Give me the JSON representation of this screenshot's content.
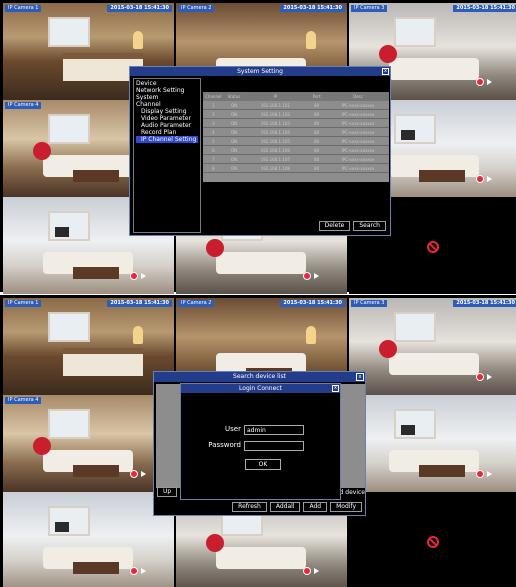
{
  "top": {
    "cells": [
      {
        "label": "IP Camera 1",
        "time": "2015-03-18 15:41:30",
        "scene": "bed"
      },
      {
        "label": "IP Camera 2",
        "time": "2015-03-18 15:41:30",
        "scene": "warm"
      },
      {
        "label": "IP Camera 3",
        "time": "2015-03-18 15:41:30",
        "scene": "grey"
      },
      {
        "label": "IP Camera 4",
        "time": "",
        "scene": "living"
      },
      {
        "label": "",
        "time": "",
        "scene": "warm"
      },
      {
        "label": "",
        "time": "",
        "scene": "white"
      },
      {
        "label": "",
        "time": "",
        "scene": "white"
      },
      {
        "label": "",
        "time": "",
        "scene": "grey"
      },
      {
        "label": "",
        "time": "",
        "scene": "dark"
      }
    ],
    "system_setting": {
      "title": "System Setting",
      "close": "x",
      "menu": [
        {
          "label": "Device",
          "sub": false,
          "active": false
        },
        {
          "label": "Network Setting",
          "sub": false,
          "active": false
        },
        {
          "label": "System",
          "sub": false,
          "active": false
        },
        {
          "label": "Channel",
          "sub": false,
          "active": false
        },
        {
          "label": "Display Setting",
          "sub": true,
          "active": false
        },
        {
          "label": "Video Parameter",
          "sub": true,
          "active": false
        },
        {
          "label": "Audio Parameter",
          "sub": true,
          "active": false
        },
        {
          "label": "Record Plan",
          "sub": true,
          "active": false
        },
        {
          "label": "IP Channel Setting",
          "sub": true,
          "active": true
        }
      ],
      "table": {
        "headers": [
          "Channel",
          "Status",
          "IP",
          "Port",
          "Desc"
        ],
        "rows": [
          [
            "1",
            "ON",
            "192.168.1.101",
            "80",
            "IPC-xxxx-xxxxxx"
          ],
          [
            "2",
            "ON",
            "192.168.1.102",
            "80",
            "IPC-xxxx-xxxxxx"
          ],
          [
            "3",
            "ON",
            "192.168.1.103",
            "80",
            "IPC-xxxx-xxxxxx"
          ],
          [
            "4",
            "ON",
            "192.168.1.104",
            "80",
            "IPC-xxxx-xxxxxx"
          ],
          [
            "5",
            "ON",
            "192.168.1.105",
            "80",
            "IPC-xxxx-xxxxxx"
          ],
          [
            "6",
            "ON",
            "192.168.1.106",
            "80",
            "IPC-xxxx-xxxxxx"
          ],
          [
            "7",
            "ON",
            "192.168.1.107",
            "80",
            "IPC-xxxx-xxxxxx"
          ],
          [
            "8",
            "ON",
            "192.168.1.108",
            "80",
            "IPC-xxxx-xxxxxx"
          ]
        ]
      },
      "buttons": {
        "delete": "Delete",
        "search": "Search"
      }
    }
  },
  "bottom": {
    "cells": [
      {
        "label": "IP Camera 1",
        "time": "2015-03-18 15:41:30",
        "scene": "bed"
      },
      {
        "label": "IP Camera 2",
        "time": "2015-03-18 15:41:30",
        "scene": "warm"
      },
      {
        "label": "IP Camera 3",
        "time": "2015-03-18 15:41:30",
        "scene": "grey"
      },
      {
        "label": "IP Camera 4",
        "time": "",
        "scene": "living"
      },
      {
        "label": "",
        "time": "",
        "scene": "warm"
      },
      {
        "label": "",
        "time": "",
        "scene": "white"
      },
      {
        "label": "",
        "time": "",
        "scene": "white"
      },
      {
        "label": "",
        "time": "",
        "scene": "grey"
      },
      {
        "label": "",
        "time": "",
        "scene": "dark"
      }
    ],
    "search_device": {
      "title": "Search device list",
      "close": "x",
      "up": "Up",
      "added_device": "ed device",
      "buttons": {
        "refresh": "Refresh",
        "addall": "Addall",
        "add": "Add",
        "modify": "Modify"
      }
    },
    "login": {
      "title": "Login Connect",
      "close": "x",
      "user_label": "User",
      "user_value": "admin",
      "password_label": "Password",
      "password_value": "",
      "ok": "OK"
    }
  },
  "colors": {
    "titlebar": "#243d8a",
    "selection": "#2f49d0",
    "camera_tag": "#2d5db8",
    "record": "#e8273a"
  }
}
